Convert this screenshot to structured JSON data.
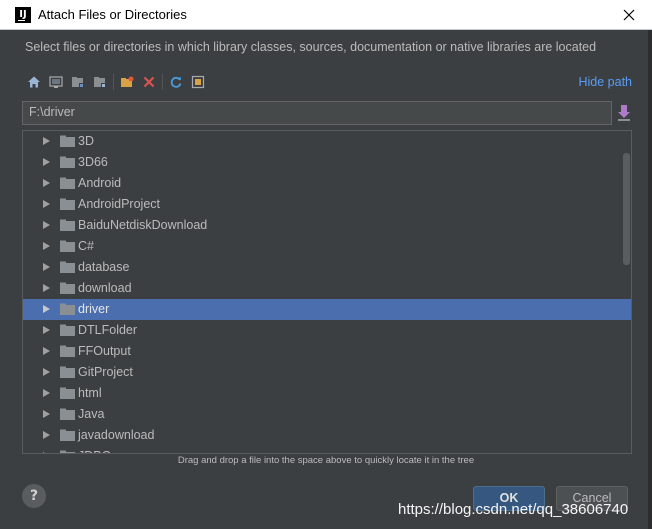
{
  "window": {
    "title": "Attach Files or Directories",
    "icon": "intellij-icon"
  },
  "description": "Select files or directories in which library classes, sources, documentation or native libraries are located",
  "toolbar": {
    "buttons": [
      "home-icon",
      "desktop-icon",
      "project-icon",
      "module-icon",
      "new-folder-icon",
      "delete-icon",
      "refresh-icon",
      "show-hidden-icon"
    ]
  },
  "hide_path_label": "Hide path",
  "path_value": "F:\\driver",
  "tree": {
    "items": [
      {
        "label": "3D",
        "selected": false
      },
      {
        "label": "3D66",
        "selected": false
      },
      {
        "label": "Android",
        "selected": false
      },
      {
        "label": "AndroidProject",
        "selected": false
      },
      {
        "label": "BaiduNetdiskDownload",
        "selected": false
      },
      {
        "label": "C#",
        "selected": false
      },
      {
        "label": "database",
        "selected": false
      },
      {
        "label": "download",
        "selected": false
      },
      {
        "label": "driver",
        "selected": true
      },
      {
        "label": "DTLFolder",
        "selected": false
      },
      {
        "label": "FFOutput",
        "selected": false
      },
      {
        "label": "GitProject",
        "selected": false
      },
      {
        "label": "html",
        "selected": false
      },
      {
        "label": "Java",
        "selected": false
      },
      {
        "label": "javadownload",
        "selected": false
      },
      {
        "label": "JDBC",
        "selected": false
      }
    ]
  },
  "hint": "Drag and drop a file into the space above to quickly locate it in the tree",
  "buttons": {
    "help": "?",
    "ok": "OK",
    "cancel": "Cancel"
  },
  "watermark": "https://blog.csdn.net/qq_38606740",
  "colors": {
    "background": "#3c3f41",
    "selection": "#4b6eaf",
    "link": "#589df6",
    "ok_button": "#365880"
  }
}
